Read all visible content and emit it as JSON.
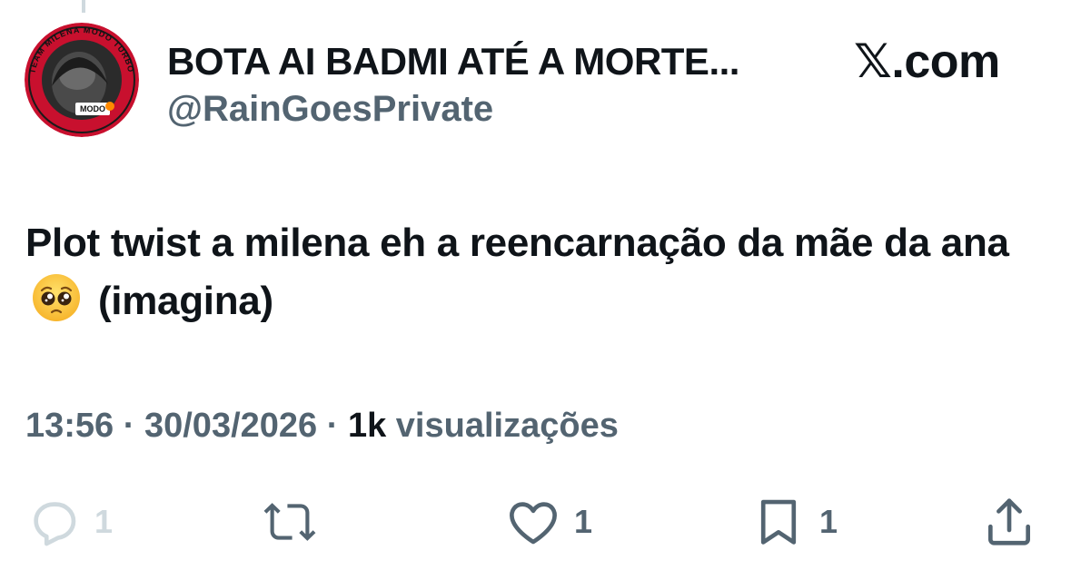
{
  "header": {
    "display_name": "BOTA AI BADMI ATÉ A MORTE...",
    "handle": "@RainGoesPrivate",
    "brand": "𝕏.com",
    "avatar_ring_text": "TEAM MILENA MODO TURBO",
    "avatar_badge": "MODO"
  },
  "tweet": {
    "text_part1": "Plot twist a milena eh a reencarnação da mãe da ana",
    "emoji": "pleading-face-emoji",
    "text_part2": "(imagina)"
  },
  "meta": {
    "time": "13:56",
    "separator1": "·",
    "date": "30/03/2026",
    "separator2": "·",
    "views_count": "1k",
    "views_label": "visualizações"
  },
  "actions": {
    "reply_count": "1",
    "like_count": "1",
    "bookmark_count": "1"
  },
  "colors": {
    "text_primary": "#0f1419",
    "text_secondary": "#536471",
    "icon_muted": "#cfd9de",
    "avatar_ring": "#c8102e"
  }
}
